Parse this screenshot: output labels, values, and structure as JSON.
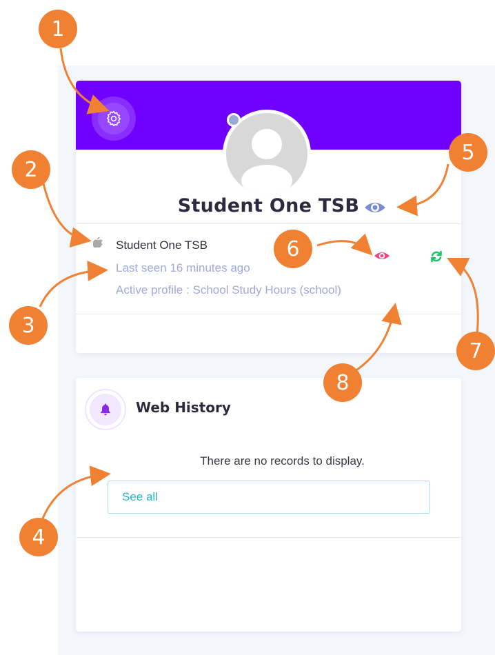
{
  "profile": {
    "name": "Student One TSB",
    "device_name": "Student One TSB",
    "last_seen": "Last seen 16 minutes ago",
    "active_profile": "Active profile : School Study Hours (school)",
    "header_color": "#6f00ff",
    "icons": {
      "settings": "gear-icon",
      "avatar": "user-avatar-icon",
      "name_visibility": "eye-icon",
      "device_os": "apple-icon",
      "status_visibility": "eye-icon",
      "refresh": "refresh-icon"
    }
  },
  "web_history": {
    "title": "Web History",
    "empty_message": "There are no records to display.",
    "see_all_label": "See all",
    "icon": "bell-icon"
  },
  "annotations": {
    "callouts": [
      "1",
      "2",
      "3",
      "4",
      "5",
      "6",
      "7",
      "8"
    ],
    "color": "#f08032"
  }
}
